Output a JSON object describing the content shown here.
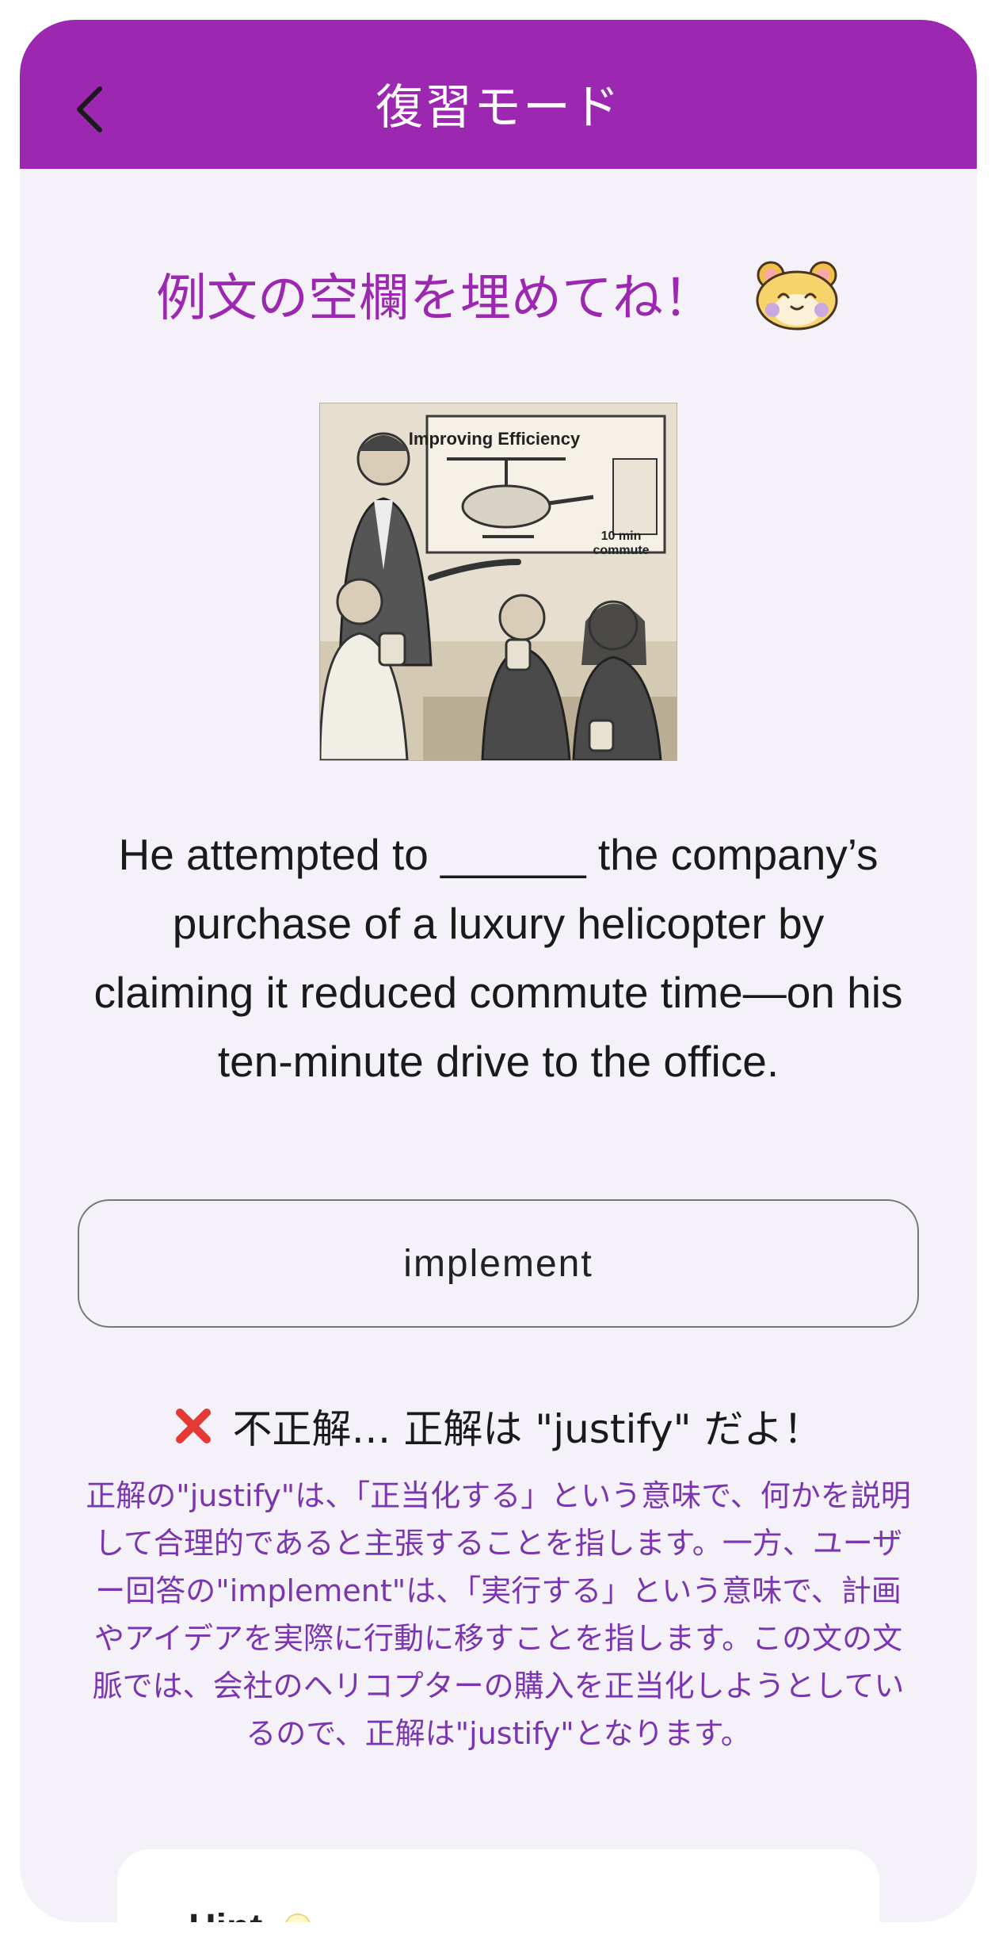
{
  "header": {
    "title": "復習モード"
  },
  "prompt": {
    "text": "例文の空欄を埋めてね！"
  },
  "illustration": {
    "sign_title": "Improving Efficiency",
    "sign_note_line1": "10 min",
    "sign_note_line2": "commute"
  },
  "sentence": "He attempted to ______ the company’s purchase of a luxury helicopter by claiming it reduced commute time—on his ten-minute drive to the office.",
  "answer": {
    "user_answer": "implement"
  },
  "result": {
    "message": "不正解… 正解は \"justify\" だよ！"
  },
  "explanation": "正解の\"justify\"は、「正当化する」という意味で、何かを説明して合理的であると主張することを指します。一方、ユーザー回答の\"implement\"は、「実行する」という意味で、計画やアイデアを実際に行動に移すことを指します。この文の文脈では、会社のヘリコプターの購入を正当化しようとしているので、正解は\"justify\"となります。",
  "hint": {
    "title": "Hint"
  },
  "colors": {
    "accent": "#9c27b0",
    "explanation_text": "#7b35b0",
    "incorrect": "#e53935"
  }
}
